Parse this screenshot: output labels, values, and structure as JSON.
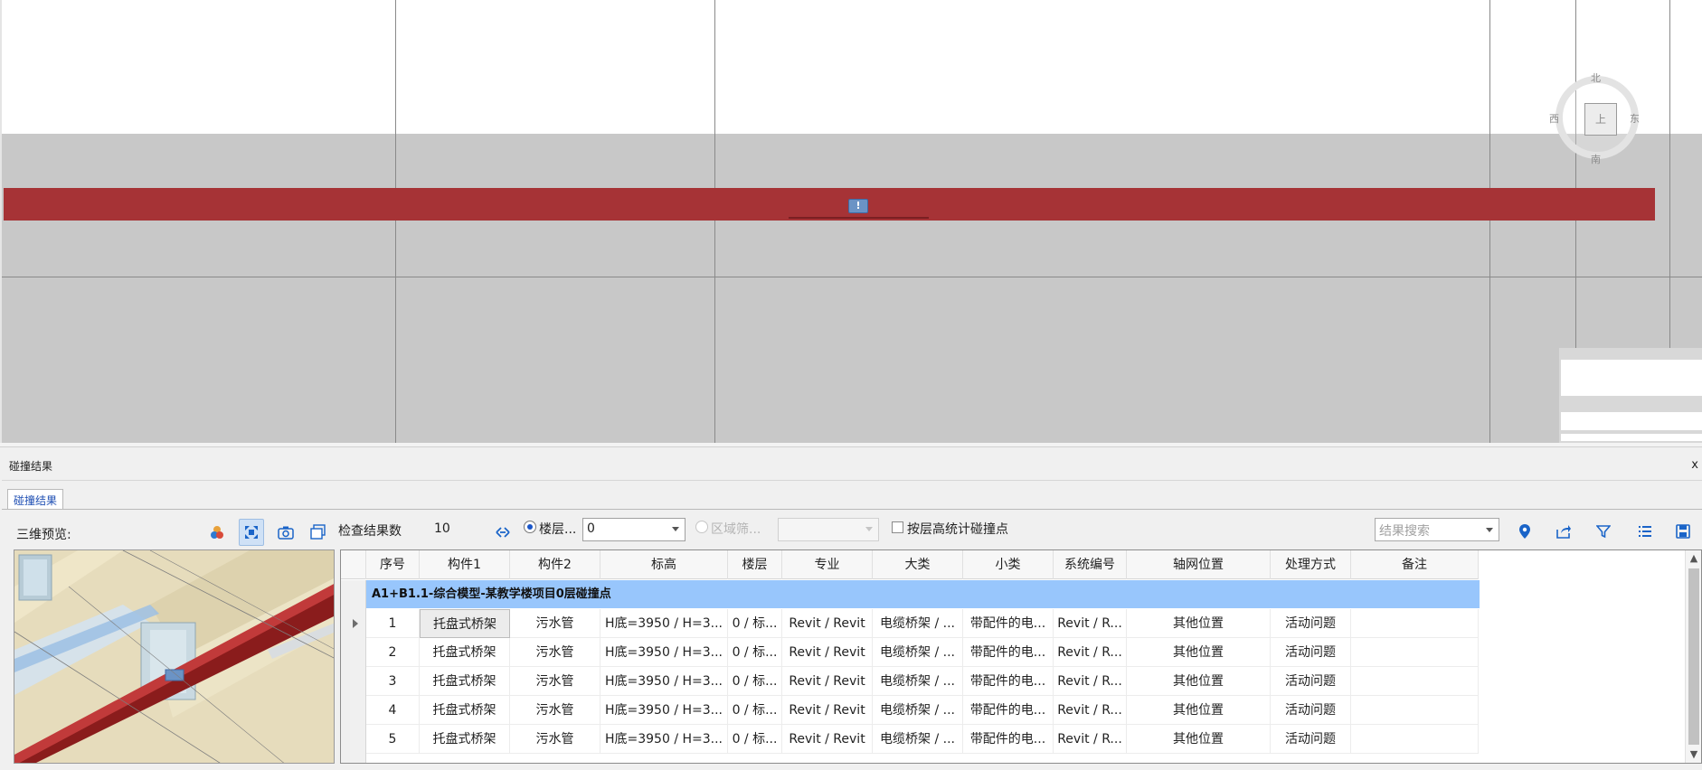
{
  "viewport": {
    "compass": {
      "north": "北",
      "south": "南",
      "east": "东",
      "west": "西",
      "face": "上"
    },
    "clash_marker": "!"
  },
  "panel": {
    "title": "碰撞结果",
    "close": "x",
    "tab": "碰撞结果",
    "preview_label": "三维预览:",
    "count_label": "检查结果数",
    "count_value": "10",
    "floor_radio_label": "楼层...",
    "floor_value": "0",
    "region_radio_label": "区域筛...",
    "region_value": "",
    "height_stat_label": "按层高统计碰撞点",
    "search_placeholder": "结果搜索",
    "accent_color": "#98c6fc"
  },
  "table": {
    "columns": [
      "序号",
      "构件1",
      "构件2",
      "标高",
      "楼层",
      "专业",
      "大类",
      "小类",
      "系统编号",
      "轴网位置",
      "处理方式",
      "备注"
    ],
    "group_title": "A1+B1.1-综合模型-某教学楼项目0层碰撞点",
    "rows": [
      {
        "no": "1",
        "c1": "托盘式桥架",
        "c2": "污水管",
        "elev": "H底=3950 / H=3...",
        "floor": "0 / 标...",
        "disc": "Revit / Revit",
        "major": "电缆桥架 / ...",
        "minor": "带配件的电...",
        "sys": "Revit / R...",
        "axis": "其他位置",
        "handle": "活动问题",
        "note": ""
      },
      {
        "no": "2",
        "c1": "托盘式桥架",
        "c2": "污水管",
        "elev": "H底=3950 / H=3...",
        "floor": "0 / 标...",
        "disc": "Revit / Revit",
        "major": "电缆桥架 / ...",
        "minor": "带配件的电...",
        "sys": "Revit / R...",
        "axis": "其他位置",
        "handle": "活动问题",
        "note": ""
      },
      {
        "no": "3",
        "c1": "托盘式桥架",
        "c2": "污水管",
        "elev": "H底=3950 / H=3...",
        "floor": "0 / 标...",
        "disc": "Revit / Revit",
        "major": "电缆桥架 / ...",
        "minor": "带配件的电...",
        "sys": "Revit / R...",
        "axis": "其他位置",
        "handle": "活动问题",
        "note": ""
      },
      {
        "no": "4",
        "c1": "托盘式桥架",
        "c2": "污水管",
        "elev": "H底=3950 / H=3...",
        "floor": "0 / 标...",
        "disc": "Revit / Revit",
        "major": "电缆桥架 / ...",
        "minor": "带配件的电...",
        "sys": "Revit / R...",
        "axis": "其他位置",
        "handle": "活动问题",
        "note": ""
      },
      {
        "no": "5",
        "c1": "托盘式桥架",
        "c2": "污水管",
        "elev": "H底=3950 / H=3...",
        "floor": "0 / 标...",
        "disc": "Revit / Revit",
        "major": "电缆桥架 / ...",
        "minor": "带配件的电...",
        "sys": "Revit / R...",
        "axis": "其他位置",
        "handle": "活动问题",
        "note": ""
      }
    ]
  },
  "icons": {
    "toolbar": [
      "color-palette-icon",
      "fit-view-icon",
      "camera-icon",
      "copy-window-icon",
      "double-arrow-icon"
    ],
    "right": [
      "location-pin-icon",
      "export-icon",
      "filter-icon",
      "list-icon",
      "save-icon"
    ]
  }
}
